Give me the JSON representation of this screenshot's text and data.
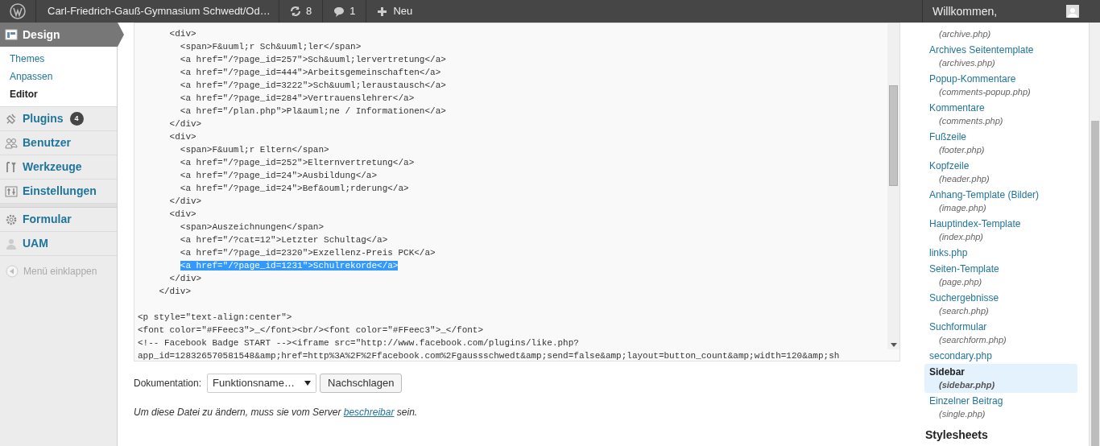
{
  "admin_bar": {
    "site_title": "Carl-Friedrich-Gauß-Gymnasium Schwedt/Od…",
    "updates": "8",
    "comments": "1",
    "new_label": "Neu",
    "greeting": "Willkommen,"
  },
  "sidebar": {
    "items": [
      {
        "label": "Design",
        "kind": "layout",
        "selected": true,
        "children": [
          {
            "label": "Themes",
            "selected": false
          },
          {
            "label": "Anpassen",
            "selected": false
          },
          {
            "label": "Editor",
            "selected": true
          }
        ]
      },
      {
        "label": "Plugins",
        "kind": "plugin",
        "selected": false,
        "badge": "4"
      },
      {
        "label": "Benutzer",
        "kind": "users",
        "selected": false
      },
      {
        "label": "Werkzeuge",
        "kind": "tools",
        "selected": false
      },
      {
        "label": "Einstellungen",
        "kind": "settings",
        "selected": false
      },
      {
        "label": "Formular",
        "kind": "gear",
        "selected": false,
        "separator_before": true
      },
      {
        "label": "UAM",
        "kind": "person",
        "selected": false
      }
    ],
    "collapse_label": "Menü einklappen"
  },
  "editor": {
    "lines": [
      {
        "text": "      <div>",
        "selected": false
      },
      {
        "text": "        <span>F&uuml;r Sch&uuml;ler</span>",
        "selected": false
      },
      {
        "text": "        <a href=\"/?page_id=257\">Sch&uuml;lervertretung</a>",
        "selected": false
      },
      {
        "text": "        <a href=\"/?page_id=444\">Arbeitsgemeinschaften</a>",
        "selected": false
      },
      {
        "text": "        <a href=\"/?page_id=3222\">Sch&uuml;leraustausch</a>",
        "selected": false
      },
      {
        "text": "        <a href=\"/?page_id=284\">Vertrauenslehrer</a>",
        "selected": false
      },
      {
        "text": "        <a href=\"/plan.php\">Pl&auml;ne / Informationen</a>",
        "selected": false
      },
      {
        "text": "      </div>",
        "selected": false
      },
      {
        "text": "      <div>",
        "selected": false
      },
      {
        "text": "        <span>F&uuml;r Eltern</span>",
        "selected": false
      },
      {
        "text": "        <a href=\"/?page_id=252\">Elternvertretung</a>",
        "selected": false
      },
      {
        "text": "        <a href=\"/?page_id=24\">Ausbildung</a>",
        "selected": false
      },
      {
        "text": "        <a href=\"/?page_id=24\">Bef&ouml;rderung</a>",
        "selected": false
      },
      {
        "text": "      </div>",
        "selected": false
      },
      {
        "text": "      <div>",
        "selected": false
      },
      {
        "text": "        <span>Auszeichnungen</span>",
        "selected": false
      },
      {
        "text": "        <a href=\"/?cat=12\">Letzter Schultag</a>",
        "selected": false
      },
      {
        "text": "        <a href=\"/?page_id=2320\">Exzellenz-Preis PCK</a>",
        "selected": false
      },
      {
        "text": "        <a href=\"/?page_id=1231\">Schulrekorde</a>",
        "selected": true
      },
      {
        "text": "      </div>",
        "selected": false
      },
      {
        "text": "    </div>",
        "selected": false
      },
      {
        "text": "<p style=\"text-align:center\">",
        "selected": false,
        "gap_before": true
      },
      {
        "text": "<font color=\"#FFeec3\">_</font><br/><font color=\"#FFeec3\">_</font>",
        "selected": false
      },
      {
        "text": "<!-- Facebook Badge START --><iframe src=\"http://www.facebook.com/plugins/like.php?",
        "selected": false
      },
      {
        "text": "app_id=128326570581548&amp;href=http%3A%2F%2Ffacebook.com%2Fgaussschwedt&amp;send=false&amp;layout=button_count&amp;width=120&amp;sh",
        "selected": false
      }
    ]
  },
  "documentation": {
    "label": "Dokumentation:",
    "select_value": "Funktionsname…",
    "button": "Nachschlagen"
  },
  "notice": "Um diese Datei zu ändern, muss sie vom Server ",
  "notice_link": "beschreibar",
  "notice_end": " sein.",
  "templates": [
    {
      "file": "(archive.php)",
      "selected": false
    },
    {
      "title": "Archives Seitentemplate",
      "file": "(archives.php)",
      "selected": false
    },
    {
      "title": "Popup-Kommentare",
      "file": "(comments-popup.php)",
      "selected": false
    },
    {
      "title": "Kommentare",
      "file": "(comments.php)",
      "selected": false
    },
    {
      "title": "Fußzeile",
      "file": "(footer.php)",
      "selected": false
    },
    {
      "title": "Kopfzeile",
      "file": "(header.php)",
      "selected": false
    },
    {
      "title": "Anhang-Template (Bilder)",
      "file": "(image.php)",
      "selected": false
    },
    {
      "title": "Hauptindex-Template",
      "file": "(index.php)",
      "selected": false
    },
    {
      "title": "links.php",
      "selected": false
    },
    {
      "title": "Seiten-Template",
      "file": "(page.php)",
      "selected": false
    },
    {
      "title": "Suchergebnisse",
      "file": "(search.php)",
      "selected": false
    },
    {
      "title": "Suchformular",
      "file": "(searchform.php)",
      "selected": false
    },
    {
      "title": "secondary.php",
      "selected": false
    },
    {
      "title": "Sidebar",
      "file": "(sidebar.php)",
      "selected": true
    },
    {
      "title": "Einzelner Beitrag",
      "file": "(single.php)",
      "selected": false
    }
  ],
  "stylesheets_heading": "Stylesheets"
}
